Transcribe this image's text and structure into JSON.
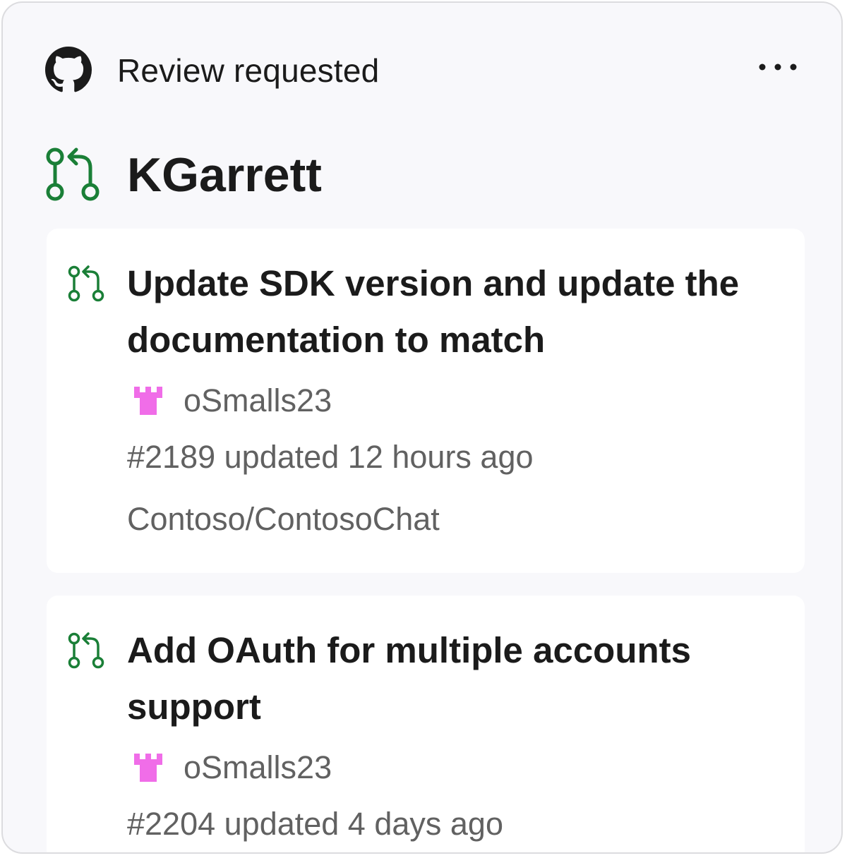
{
  "header": {
    "title": "Review requested",
    "logo_icon": "github-icon",
    "more_icon": "more-icon"
  },
  "user": {
    "name": "KGarrett",
    "icon": "pull-request-icon"
  },
  "colors": {
    "accent_green": "#1a7f37",
    "avatar_pink": "#f06de8",
    "text_primary": "#1b1b1b",
    "text_secondary": "#616161"
  },
  "pull_requests": [
    {
      "title": "Update SDK version and update the documentation to match",
      "author": "oSmalls23",
      "updated": "#2189 updated 12 hours ago",
      "repo": "Contoso/ContosoChat"
    },
    {
      "title": "Add OAuth for multiple accounts support",
      "author": "oSmalls23",
      "updated": "#2204 updated 4 days ago"
    }
  ]
}
